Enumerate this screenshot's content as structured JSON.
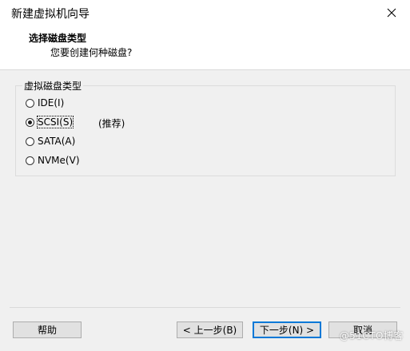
{
  "window": {
    "title": "新建虚拟机向导"
  },
  "header": {
    "title": "选择磁盘类型",
    "subtitle": "您要创建何种磁盘?"
  },
  "group": {
    "legend": "虚拟磁盘类型",
    "options": [
      {
        "label": "IDE(I)",
        "selected": false
      },
      {
        "label": "SCSI(S)",
        "selected": true
      },
      {
        "label": "SATA(A)",
        "selected": false
      },
      {
        "label": "NVMe(V)",
        "selected": false
      }
    ],
    "recommended_note": "(推荐)"
  },
  "buttons": {
    "help": "帮助",
    "back": "< 上一步(B)",
    "next": "下一步(N) >",
    "cancel": "取消"
  },
  "watermark": "@51CTO博客",
  "colors": {
    "window_bg": "#f0f0f0",
    "header_bg": "#ffffff",
    "button_bg": "#e1e1e1",
    "focus_border": "#0078d7"
  }
}
